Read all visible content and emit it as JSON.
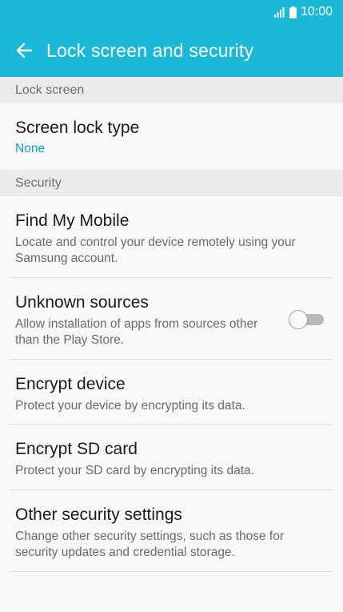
{
  "status_bar": {
    "time": "10:00"
  },
  "app_bar": {
    "title": "Lock screen and security"
  },
  "sections": [
    {
      "header": "Lock screen",
      "items": [
        {
          "title": "Screen lock type",
          "value": "None"
        }
      ]
    },
    {
      "header": "Security",
      "items": [
        {
          "title": "Find My Mobile",
          "subtitle": "Locate and control your device remotely using your Samsung account."
        },
        {
          "title": "Unknown sources",
          "subtitle": "Allow installation of apps from sources other than the Play Store.",
          "toggle_on": false
        },
        {
          "title": "Encrypt device",
          "subtitle": "Protect your device by encrypting its data."
        },
        {
          "title": "Encrypt SD card",
          "subtitle": "Protect your SD card by encrypting its data."
        },
        {
          "title": "Other security settings",
          "subtitle": "Change other security settings, such as those for security updates and credential storage."
        }
      ]
    }
  ],
  "colors": {
    "accent": "#1ab8d9",
    "value_text": "#0b9ec4"
  }
}
